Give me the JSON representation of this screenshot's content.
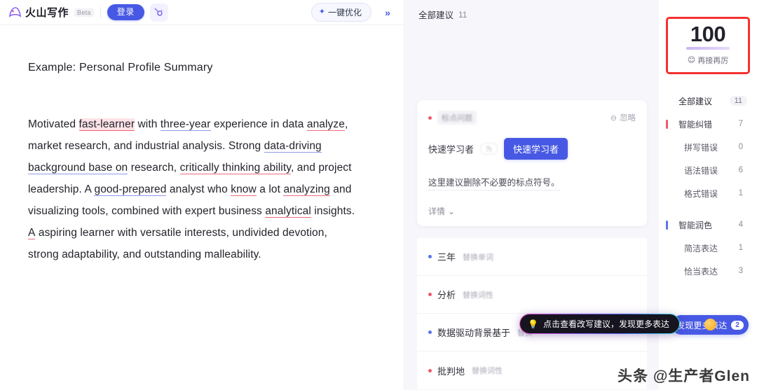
{
  "header": {
    "brand_name": "火山写作",
    "beta_label": "Beta",
    "login_label": "登录",
    "wand_icon": "magic-wand-icon",
    "optimize_label": "一键优化",
    "collapse_label": "»"
  },
  "editor": {
    "title": "Example: Personal Profile Summary",
    "paragraph_segments": [
      {
        "text": "Motivated ",
        "mark": "none"
      },
      {
        "text": "fast-learner",
        "mark": "red-highlight"
      },
      {
        "text": " with ",
        "mark": "none"
      },
      {
        "text": "three-year",
        "mark": "blue"
      },
      {
        "text": " experience in data ",
        "mark": "none"
      },
      {
        "text": "analyze",
        "mark": "red"
      },
      {
        "text": ", market research, and industrial analysis. Strong ",
        "mark": "none"
      },
      {
        "text": "data-driving background base on",
        "mark": "blue"
      },
      {
        "text": " research, ",
        "mark": "none"
      },
      {
        "text": "critically thinking ability",
        "mark": "red"
      },
      {
        "text": ", and project leadership. A ",
        "mark": "none"
      },
      {
        "text": "good-prepared",
        "mark": "blue"
      },
      {
        "text": " analyst who ",
        "mark": "none"
      },
      {
        "text": "know",
        "mark": "red"
      },
      {
        "text": " a lot ",
        "mark": "none"
      },
      {
        "text": "analyzing",
        "mark": "red"
      },
      {
        "text": " and visualizing tools, combined with expert business ",
        "mark": "none"
      },
      {
        "text": "analytical",
        "mark": "red"
      },
      {
        "text": " insights. ",
        "mark": "none"
      },
      {
        "text": "A",
        "mark": "red"
      },
      {
        "text": " aspiring learner with versatile interests, undivided devotion, strong adaptability, and outstanding malleability.",
        "mark": "none"
      }
    ]
  },
  "suggestions": {
    "header_label": "全部建议",
    "header_count": "11",
    "card": {
      "dot_color": "#f0596c",
      "category": "标点问题",
      "ignore_label": "忽略",
      "ignore_icon": "minus-circle-icon",
      "original_text": "快速学习者",
      "change_pill": "为",
      "replacement_text": "快速学习者",
      "explanation": "这里建议删除不必要的标点符号。",
      "detail_label": "详情",
      "detail_icon": "chevron-down-icon"
    },
    "rows": [
      {
        "dot": "blue",
        "word": "三年",
        "action": "替换单词"
      },
      {
        "dot": "red",
        "word": "分析",
        "action": "替换词性"
      },
      {
        "dot": "blue",
        "word": "数据驱动背景基于",
        "action": "替换"
      },
      {
        "dot": "red",
        "word": "批判地",
        "action": "替换词性"
      }
    ],
    "tooltip": {
      "icon": "lightbulb-icon",
      "text": "点击查看改写建议，发现更多表达"
    }
  },
  "sidebar": {
    "score": "100",
    "score_emoji": "😊",
    "score_caption": "再接再厉",
    "nav": [
      {
        "label": "全部建议",
        "count": "11",
        "type": "head",
        "bar": "none"
      },
      {
        "label": "智能纠错",
        "count": "7",
        "type": "group",
        "bar": "red"
      },
      {
        "label": "拼写错误",
        "count": "0",
        "type": "sub",
        "bar": "none"
      },
      {
        "label": "语法错误",
        "count": "6",
        "type": "sub",
        "bar": "none"
      },
      {
        "label": "格式错误",
        "count": "1",
        "type": "sub",
        "bar": "none"
      },
      {
        "label": "智能润色",
        "count": "4",
        "type": "group",
        "bar": "blue"
      },
      {
        "label": "简洁表达",
        "count": "1",
        "type": "sub",
        "bar": "none"
      },
      {
        "label": "恰当表达",
        "count": "3",
        "type": "sub",
        "bar": "none"
      }
    ],
    "more_button_label": "发现更多表达",
    "more_button_badge": "2"
  },
  "watermark": "头条 @生产者Glen",
  "colors": {
    "accent": "#4759e4",
    "error": "#f0596c",
    "polish": "#5b74e8",
    "score_border": "#f5312f",
    "panel_bg": "#f7f7fb"
  }
}
